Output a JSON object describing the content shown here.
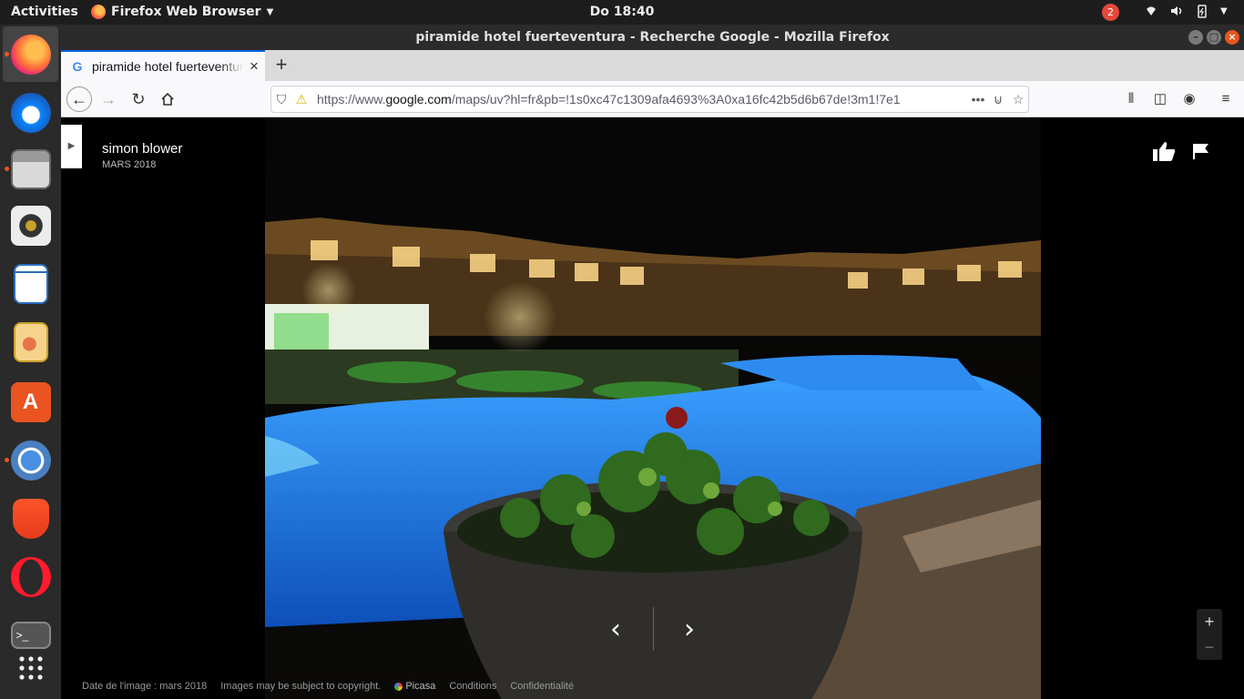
{
  "topbar": {
    "activities": "Activities",
    "app_menu": "Firefox Web Browser",
    "clock": "Do 18:40",
    "notification_count": "2"
  },
  "dock": {
    "items": [
      "firefox",
      "thunderbird",
      "files",
      "rhythmbox",
      "libreoffice-writer",
      "libreoffice-impress",
      "ubuntu-software",
      "chromium",
      "brave",
      "opera",
      "terminal",
      "show-applications"
    ]
  },
  "window": {
    "title": "piramide hotel fuerteventura - Recherche Google - Mozilla Firefox"
  },
  "tabs": [
    {
      "label": "piramide hotel fuerteventura - Recherche Google",
      "favicon": "G"
    }
  ],
  "navbar": {
    "url_prefix": "https://www.",
    "url_host": "google.com",
    "url_rest": "/maps/uv?hl=fr&pb=!1s0xc47c1309afa4693%3A0xa16fc42b5d6b67de!3m1!7e1"
  },
  "viewer": {
    "author": "simon blower",
    "date": "MARS 2018",
    "footer": {
      "image_date": "Date de l'image : mars 2018",
      "copyright": "Images may be subject to copyright.",
      "picasa": "Picasa",
      "conditions": "Conditions",
      "privacy": "Confidentialité"
    }
  },
  "colors": {
    "ubuntu_orange": "#e95420",
    "firefox_blue": "#0060df",
    "pool_blue": "#1a6fd6"
  }
}
